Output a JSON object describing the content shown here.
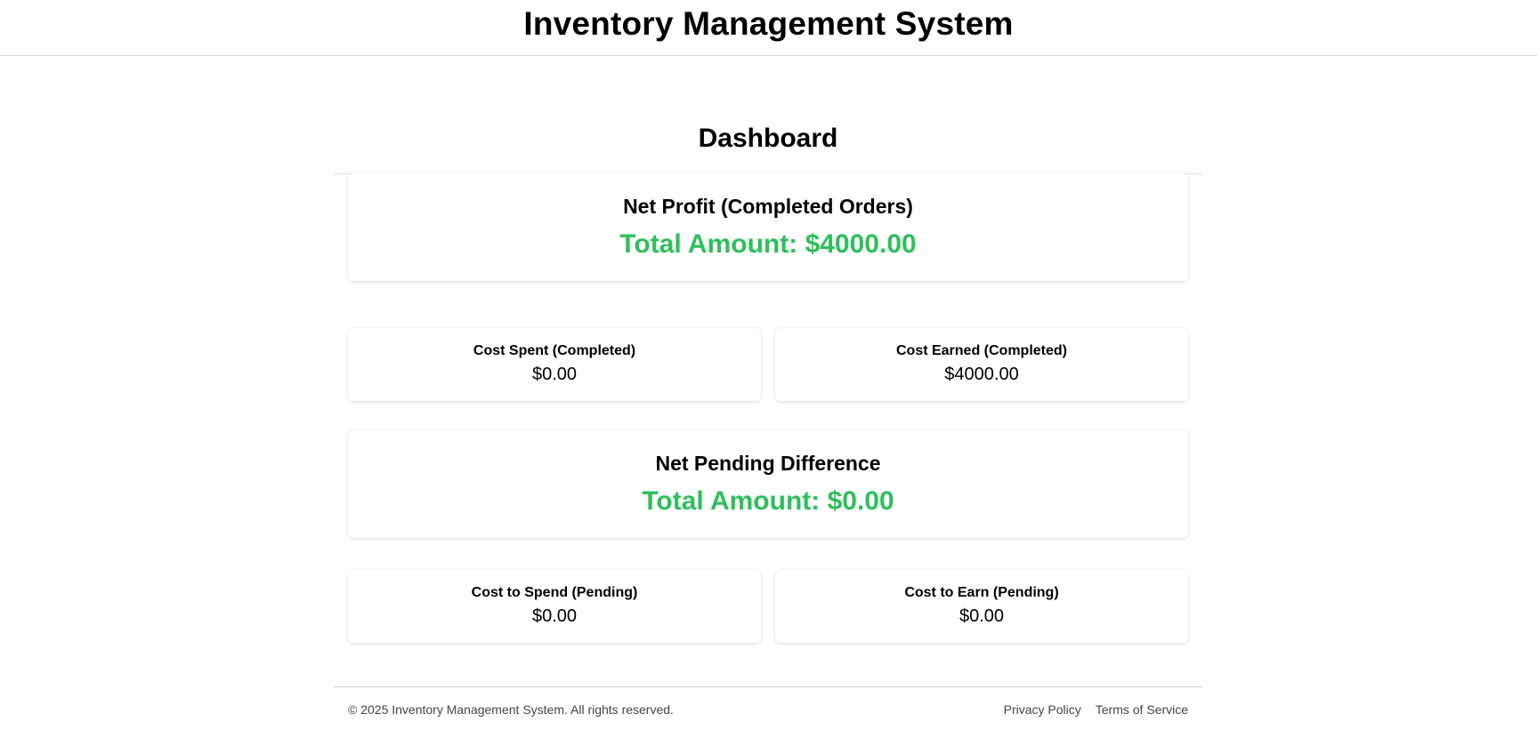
{
  "header": {
    "title": "Inventory Management System"
  },
  "dashboard": {
    "heading": "Dashboard",
    "net_profit": {
      "label": "Net Profit (Completed Orders)",
      "amount": "Total Amount: $4000.00"
    },
    "completed": [
      {
        "label": "Cost Spent (Completed)",
        "value": "$0.00"
      },
      {
        "label": "Cost Earned (Completed)",
        "value": "$4000.00"
      }
    ],
    "net_pending": {
      "label": "Net Pending Difference",
      "amount": "Total Amount: $0.00"
    },
    "pending": [
      {
        "label": "Cost to Spend (Pending)",
        "value": "$0.00"
      },
      {
        "label": "Cost to Earn (Pending)",
        "value": "$0.00"
      }
    ]
  },
  "footer": {
    "copyright": "© 2025 Inventory Management System. All rights reserved.",
    "links": [
      "Privacy Policy",
      "Terms of Service"
    ]
  },
  "colors": {
    "positive_amount": "#2ebf5c",
    "text": "#000000",
    "footer_text": "#444444"
  }
}
